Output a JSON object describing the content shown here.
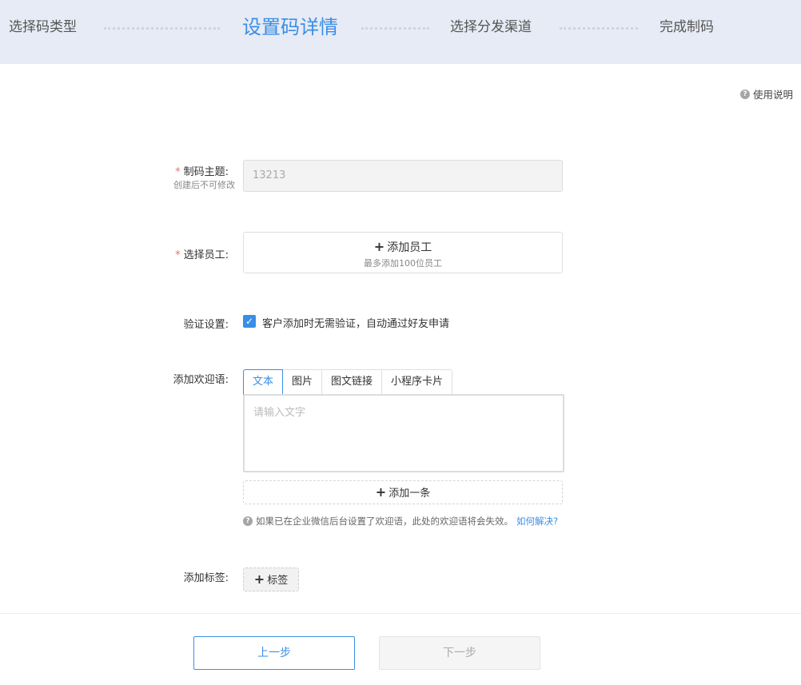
{
  "steps": [
    {
      "label": "选择码类型",
      "active": false
    },
    {
      "label": "设置码详情",
      "active": true
    },
    {
      "label": "选择分发渠道",
      "active": false
    },
    {
      "label": "完成制码",
      "active": false
    }
  ],
  "help": {
    "icon": "question-icon",
    "label": "使用说明"
  },
  "form": {
    "required_mark": "*",
    "subject": {
      "label": "制码主题:",
      "sublabel": "创建后不可修改",
      "value": "13213"
    },
    "staff": {
      "label": "选择员工:",
      "button_plus": "+",
      "button_label": "添加员工",
      "hint": "最多添加100位员工"
    },
    "verify": {
      "label": "验证设置:",
      "checked": true,
      "check_mark": "✓",
      "checkbox_label": "客户添加时无需验证，自动通过好友申请"
    },
    "welcome": {
      "label": "添加欢迎语:",
      "tabs": [
        "文本",
        "图片",
        "图文链接",
        "小程序卡片"
      ],
      "active_tab": "文本",
      "placeholder": "请输入文字",
      "add_plus": "+",
      "add_label": "添加一条",
      "tip_icon": "question-icon",
      "tip_text": "如果已在企业微信后台设置了欢迎语，此处的欢迎语将会失效。",
      "tip_link": "如何解决?"
    },
    "tags": {
      "label": "添加标签:",
      "button_plus": "+",
      "button_label": "标签"
    }
  },
  "footer": {
    "prev_label": "上一步",
    "next_label": "下一步"
  },
  "colors": {
    "accent": "#3a8ee6",
    "required": "#f56c6c",
    "header_bg": "#e6ebf5"
  }
}
